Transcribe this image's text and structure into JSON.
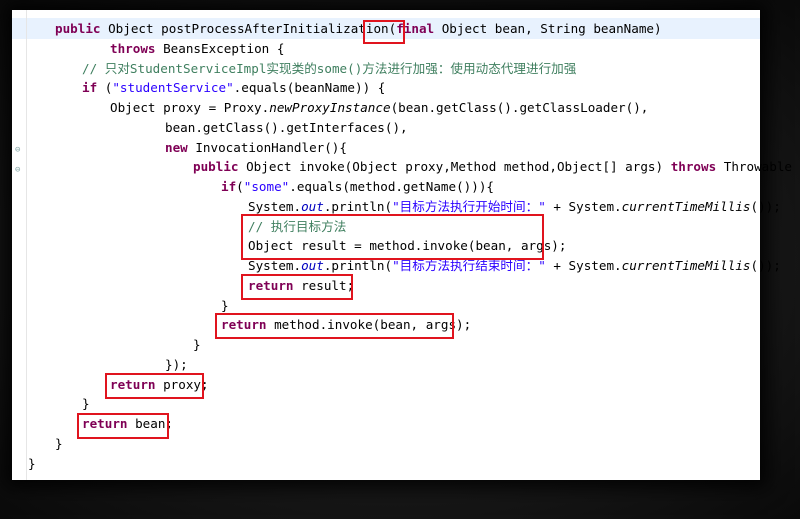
{
  "code_lines": [
    {
      "indent": 1,
      "tokens": [
        {
          "t": "public",
          "c": "kw"
        },
        {
          "t": " Object postProcessAfterInitialization(",
          "c": ""
        },
        {
          "t": "final",
          "c": "kw"
        },
        {
          "t": " Object bean, String beanName)",
          "c": ""
        }
      ]
    },
    {
      "indent": 3,
      "tokens": [
        {
          "t": "throws",
          "c": "kw"
        },
        {
          "t": " BeansException {",
          "c": ""
        }
      ]
    },
    {
      "indent": 2,
      "tokens": [
        {
          "t": "// 只对StudentServiceImpl实现类的some()方法进行加强：使用动态代理进行加强",
          "c": "cm"
        }
      ]
    },
    {
      "indent": 2,
      "tokens": [
        {
          "t": "if",
          "c": "kw"
        },
        {
          "t": " (",
          "c": ""
        },
        {
          "t": "\"studentService\"",
          "c": "str"
        },
        {
          "t": ".equals(beanName)) {",
          "c": ""
        }
      ]
    },
    {
      "indent": 3,
      "tokens": [
        {
          "t": "Object proxy = Proxy.",
          "c": ""
        },
        {
          "t": "newProxyInstance",
          "c": "it"
        },
        {
          "t": "(bean.getClass().getClassLoader(),",
          "c": ""
        }
      ]
    },
    {
      "indent": 5,
      "tokens": [
        {
          "t": "bean.getClass().getInterfaces(),",
          "c": ""
        }
      ]
    },
    {
      "indent": 5,
      "tokens": [
        {
          "t": "new",
          "c": "kw"
        },
        {
          "t": " InvocationHandler(){",
          "c": ""
        }
      ]
    },
    {
      "indent": 6,
      "tokens": [
        {
          "t": "public",
          "c": "kw"
        },
        {
          "t": " Object invoke(Object proxy,Method method,Object[] args) ",
          "c": ""
        },
        {
          "t": "throws",
          "c": "kw"
        },
        {
          "t": " Throwable {",
          "c": ""
        }
      ]
    },
    {
      "indent": 7,
      "tokens": [
        {
          "t": "if",
          "c": "kw"
        },
        {
          "t": "(",
          "c": ""
        },
        {
          "t": "\"some\"",
          "c": "str"
        },
        {
          "t": ".equals(method.getName())){",
          "c": ""
        }
      ]
    },
    {
      "indent": 8,
      "tokens": [
        {
          "t": "System.",
          "c": ""
        },
        {
          "t": "out",
          "c": "fld"
        },
        {
          "t": ".println(",
          "c": ""
        },
        {
          "t": "\"目标方法执行开始时间：\"",
          "c": "str"
        },
        {
          "t": " + System.",
          "c": ""
        },
        {
          "t": "currentTimeMillis",
          "c": "it"
        },
        {
          "t": "());",
          "c": ""
        }
      ]
    },
    {
      "indent": 8,
      "tokens": [
        {
          "t": "// 执行目标方法",
          "c": "cm"
        }
      ]
    },
    {
      "indent": 8,
      "tokens": [
        {
          "t": "Object result = method.invoke(bean, args);",
          "c": ""
        }
      ]
    },
    {
      "indent": 8,
      "tokens": [
        {
          "t": "System.",
          "c": ""
        },
        {
          "t": "out",
          "c": "fld"
        },
        {
          "t": ".println(",
          "c": ""
        },
        {
          "t": "\"目标方法执行结束时间：\"",
          "c": "str"
        },
        {
          "t": " + System.",
          "c": ""
        },
        {
          "t": "currentTimeMillis",
          "c": "it"
        },
        {
          "t": "());",
          "c": ""
        }
      ]
    },
    {
      "indent": 8,
      "tokens": [
        {
          "t": "return",
          "c": "kw"
        },
        {
          "t": " result;",
          "c": ""
        }
      ]
    },
    {
      "indent": 7,
      "tokens": [
        {
          "t": "}",
          "c": ""
        }
      ]
    },
    {
      "indent": 7,
      "tokens": [
        {
          "t": "return",
          "c": "kw"
        },
        {
          "t": " method.invoke(bean, args);",
          "c": ""
        }
      ]
    },
    {
      "indent": 6,
      "tokens": [
        {
          "t": "}",
          "c": ""
        }
      ]
    },
    {
      "indent": 5,
      "tokens": [
        {
          "t": "});",
          "c": ""
        }
      ]
    },
    {
      "indent": 3,
      "tokens": [
        {
          "t": "return",
          "c": "kw"
        },
        {
          "t": " proxy;",
          "c": ""
        }
      ]
    },
    {
      "indent": 2,
      "tokens": [
        {
          "t": "}",
          "c": ""
        }
      ]
    },
    {
      "indent": 2,
      "tokens": [
        {
          "t": "return",
          "c": "kw"
        },
        {
          "t": " bean;",
          "c": ""
        }
      ]
    },
    {
      "indent": 1,
      "tokens": [
        {
          "t": "}",
          "c": ""
        }
      ]
    },
    {
      "indent": 0,
      "tokens": [
        {
          "t": "}",
          "c": ""
        }
      ]
    }
  ],
  "fold_markers": [
    "⊖",
    "⊖"
  ],
  "colors": {
    "keyword": "#7f0055",
    "string": "#2a00ff",
    "comment": "#3f7f5f",
    "field": "#0000c0",
    "highlight_box": "#e0141e",
    "current_line": "#e8f2fe"
  }
}
